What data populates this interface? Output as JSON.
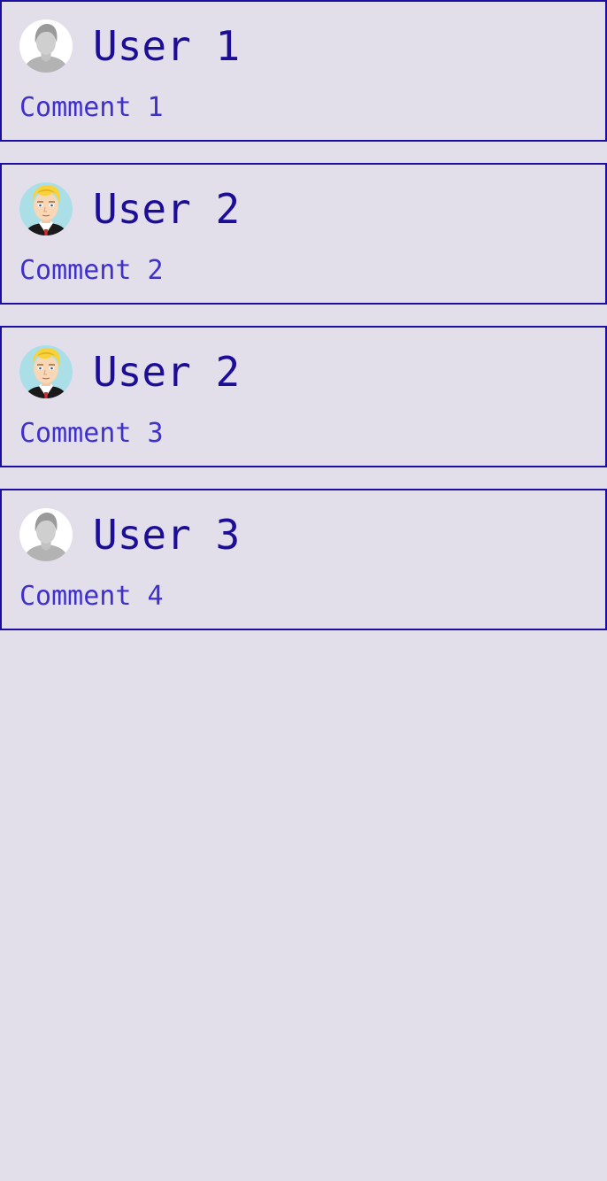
{
  "colors": {
    "background": "#e2dfea",
    "card_border": "#1c0fa0",
    "user_name": "#1c0e96",
    "comment_text": "#3f30cc"
  },
  "comments": [
    {
      "user": "User 1",
      "text": "Comment 1",
      "avatar": "default-avatar-icon"
    },
    {
      "user": "User 2",
      "text": "Comment 2",
      "avatar": "blond-man-avatar-icon"
    },
    {
      "user": "User 2",
      "text": "Comment 3",
      "avatar": "blond-man-avatar-icon"
    },
    {
      "user": "User 3",
      "text": "Comment 4",
      "avatar": "default-avatar-icon"
    }
  ]
}
